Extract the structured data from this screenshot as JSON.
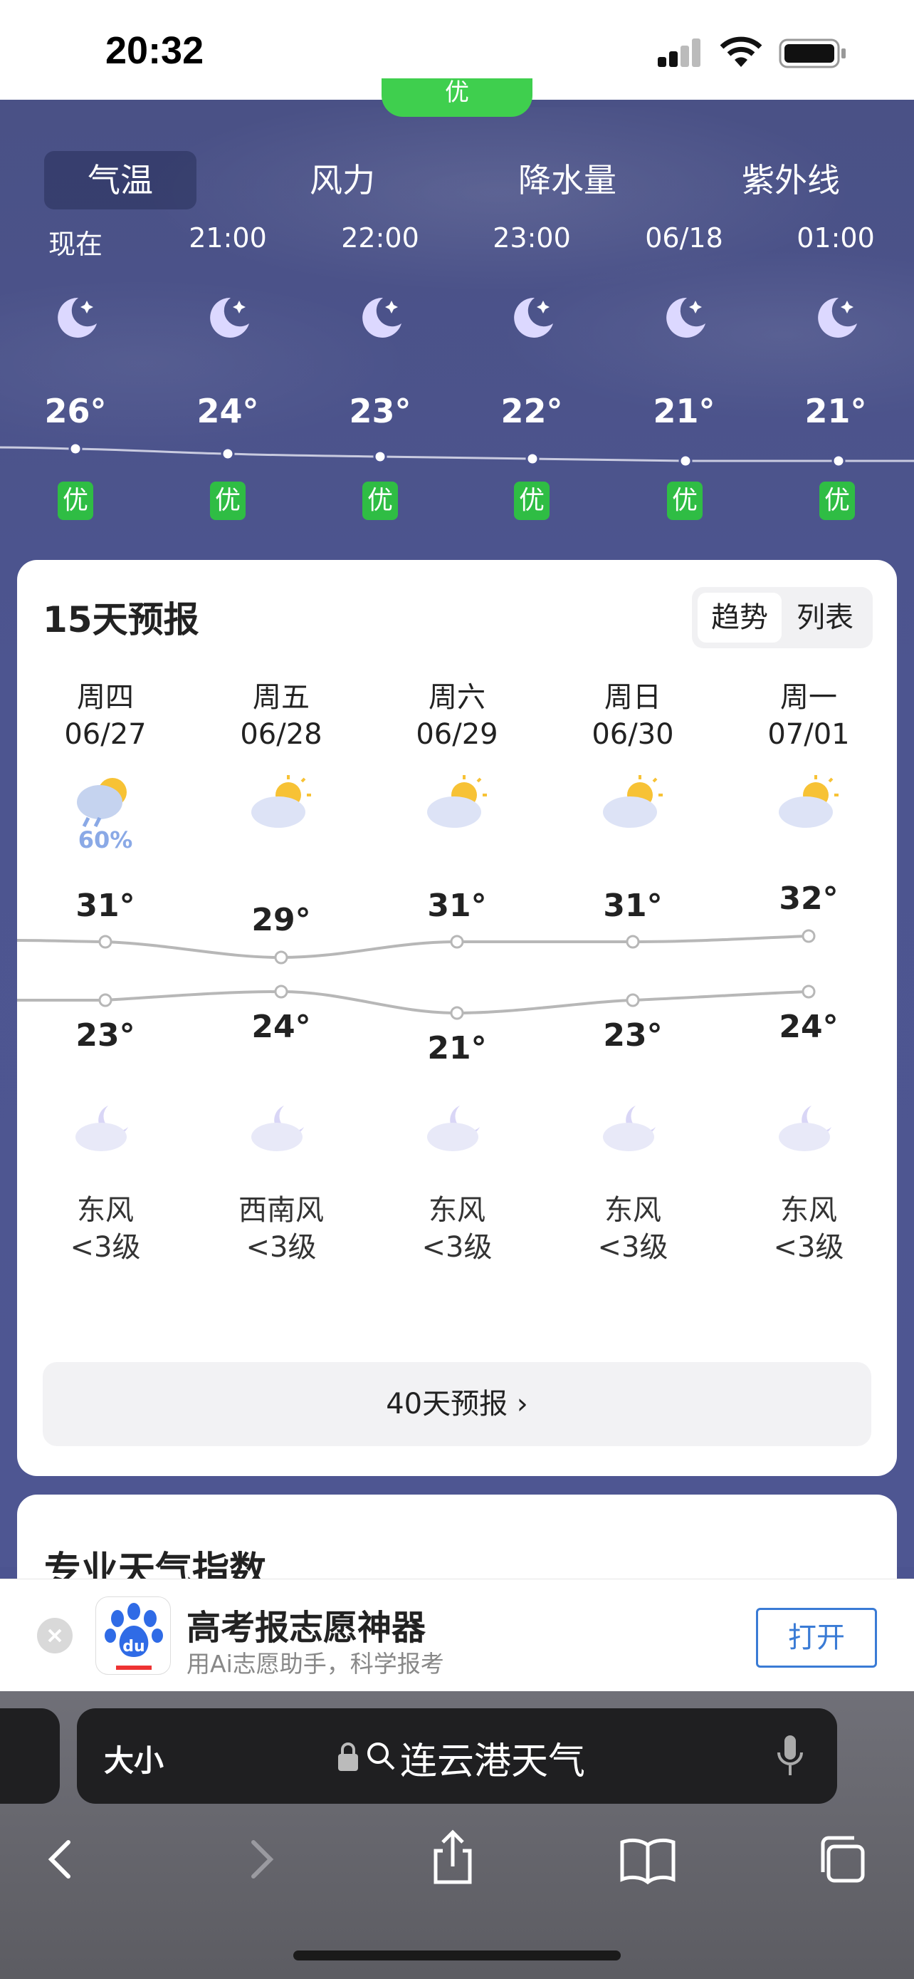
{
  "status_bar": {
    "time": "20:32"
  },
  "aqi_top_label": "优",
  "tabs": [
    {
      "label": "气温"
    },
    {
      "label": "风力"
    },
    {
      "label": "降水量"
    },
    {
      "label": "紫外线"
    }
  ],
  "hourly": [
    {
      "time": "现在",
      "temp": "26°",
      "aqi": "优",
      "icon": "moon-stars-icon"
    },
    {
      "time": "21:00",
      "temp": "24°",
      "aqi": "优",
      "icon": "moon-stars-icon"
    },
    {
      "time": "22:00",
      "temp": "23°",
      "aqi": "优",
      "icon": "moon-stars-icon"
    },
    {
      "time": "23:00",
      "temp": "22°",
      "aqi": "优",
      "icon": "moon-stars-icon"
    },
    {
      "time": "06/18",
      "temp": "21°",
      "aqi": "优",
      "icon": "moon-stars-icon"
    },
    {
      "time": "01:00",
      "temp": "21°",
      "aqi": "优",
      "icon": "moon-stars-icon"
    }
  ],
  "forecast": {
    "title": "15天预报",
    "toggle": {
      "trend": "趋势",
      "list": "列表",
      "selected": "趋势"
    },
    "days": [
      {
        "weekday": "周四",
        "date": "06/27",
        "high": "31°",
        "low": "23°",
        "precip": "60%",
        "day_icon": "thunder-shower-icon",
        "night_icon": "cloudy-night-icon",
        "wind_dir": "东风",
        "wind_level": "<3级"
      },
      {
        "weekday": "周五",
        "date": "06/28",
        "high": "29°",
        "low": "24°",
        "precip": "",
        "day_icon": "partly-cloudy-icon",
        "night_icon": "cloudy-night-icon",
        "wind_dir": "西南风",
        "wind_level": "<3级"
      },
      {
        "weekday": "周六",
        "date": "06/29",
        "high": "31°",
        "low": "21°",
        "precip": "",
        "day_icon": "partly-cloudy-icon",
        "night_icon": "cloudy-night-icon",
        "wind_dir": "东风",
        "wind_level": "<3级"
      },
      {
        "weekday": "周日",
        "date": "06/30",
        "high": "31°",
        "low": "23°",
        "precip": "",
        "day_icon": "partly-cloudy-icon",
        "night_icon": "cloudy-night-icon",
        "wind_dir": "东风",
        "wind_level": "<3级"
      },
      {
        "weekday": "周一",
        "date": "07/01",
        "high": "32°",
        "low": "24°",
        "precip": "",
        "day_icon": "partly-cloudy-icon",
        "night_icon": "cloudy-night-icon",
        "wind_dir": "东风",
        "wind_level": "<3级"
      }
    ],
    "more_label": "40天预报 ›"
  },
  "pro_section": {
    "title": "专业天气指数"
  },
  "ad": {
    "title": "高考报志愿神器",
    "subtitle": "用Ai志愿助手，科学报考",
    "button": "打开",
    "logo_text": "du"
  },
  "browser": {
    "text_size_label": "大小",
    "address_text": "连云港天气"
  },
  "colors": {
    "sky": "#4c5490",
    "aqi_green": "#2fbd44",
    "accent_blue": "#3a7bd5"
  }
}
